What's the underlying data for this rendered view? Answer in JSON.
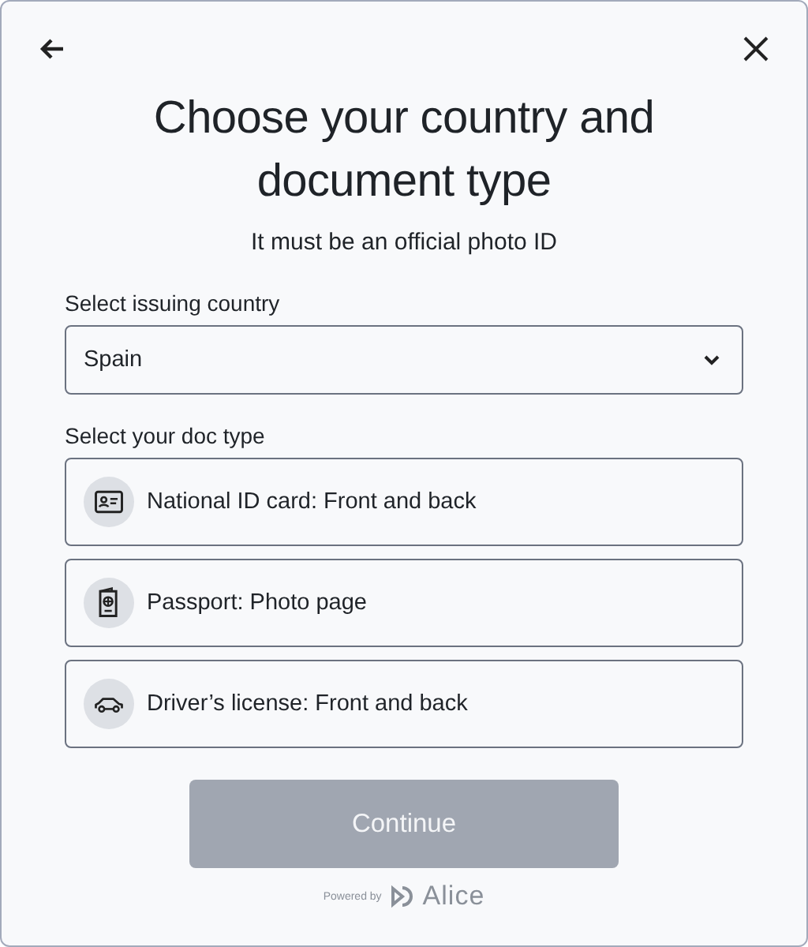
{
  "title": "Choose your country and document type",
  "subtitle": "It must be an official photo ID",
  "country": {
    "label": "Select issuing country",
    "value": "Spain"
  },
  "doc_type": {
    "label": "Select your doc type",
    "options": [
      {
        "kind": "id-card",
        "label": "National ID card: Front and back"
      },
      {
        "kind": "passport",
        "label": "Passport: Photo page"
      },
      {
        "kind": "car",
        "label": "Driver’s license: Front and back"
      }
    ]
  },
  "continue_button": {
    "label": "Continue",
    "disabled": true
  },
  "footer": {
    "powered_by": "Powered by",
    "brand": "Alice"
  }
}
